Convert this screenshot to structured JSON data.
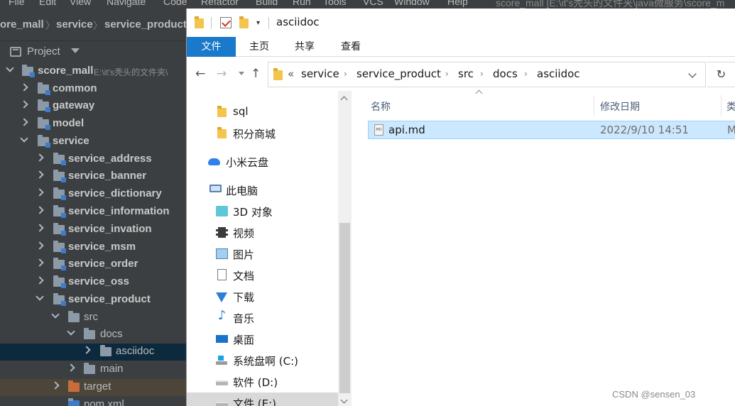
{
  "ide": {
    "menu": [
      "File",
      "Edit",
      "View",
      "Navigate",
      "Code",
      "Refactor",
      "Build",
      "Run",
      "Tools",
      "VCS",
      "Window",
      "Help"
    ],
    "window_title": "score_mall [E:\\it's秃头的文件夹\\java微服务\\score_m",
    "breadcrumb": [
      "ore_mall",
      "service",
      "service_product"
    ],
    "project_label": "Project",
    "tree": {
      "root_label": "score_mall",
      "root_path": "E:\\it's秃头的文件夹\\",
      "items": [
        "common",
        "gateway",
        "model",
        "service",
        "service_address",
        "service_banner",
        "service_dictionary",
        "service_information",
        "service_invation",
        "service_msm",
        "service_order",
        "service_oss",
        "service_product",
        "src",
        "docs",
        "asciidoc",
        "main",
        "target",
        "pom.xml"
      ]
    }
  },
  "explorer": {
    "title": "asciidoc",
    "ribbon_tabs": [
      "文件",
      "主页",
      "共享",
      "查看"
    ],
    "nav_buttons": [
      "←",
      "→",
      "↑"
    ],
    "address": {
      "overflow": "«",
      "crumbs": [
        "service",
        "service_product",
        "src",
        "docs",
        "asciidoc"
      ]
    },
    "refresh": "↻",
    "navpane": [
      "sql",
      "积分商城",
      "小米云盘",
      "此电脑",
      "3D 对象",
      "视频",
      "图片",
      "文档",
      "下载",
      "音乐",
      "桌面",
      "系统盘啊 (C:)",
      "软件 (D:)",
      "文件 (E:)"
    ],
    "columns": [
      "名称",
      "修改日期",
      "类"
    ],
    "files": [
      {
        "name": "api.md",
        "modified": "2022/9/10 14:51",
        "type": "M",
        "icon": "MD"
      }
    ]
  },
  "watermark": "CSDN @sensen_03"
}
